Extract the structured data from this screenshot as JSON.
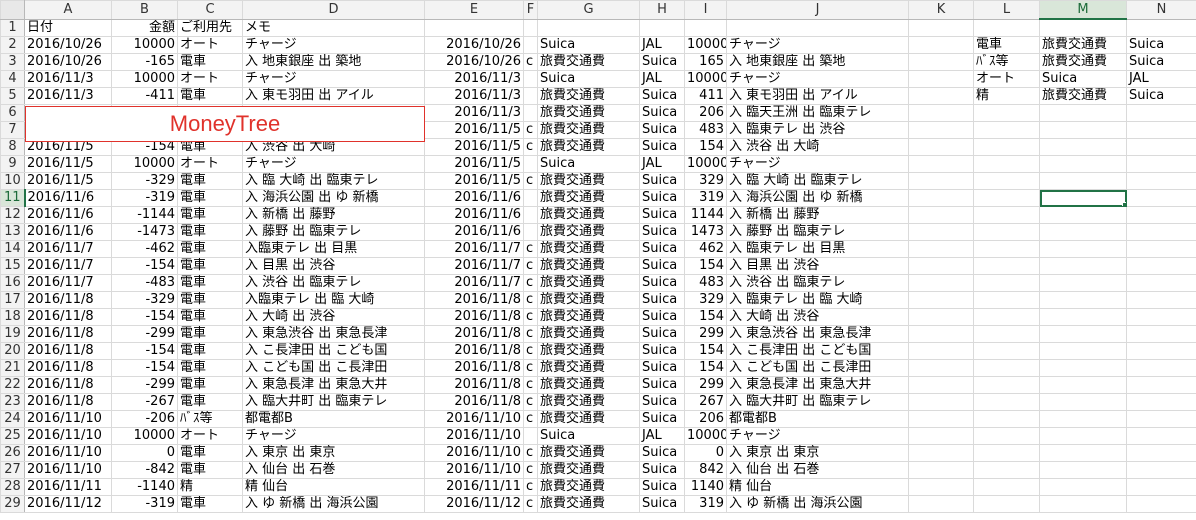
{
  "columns": [
    "A",
    "B",
    "C",
    "D",
    "E",
    "F",
    "G",
    "H",
    "I",
    "J",
    "K",
    "L",
    "M",
    "N"
  ],
  "selected_column": "M",
  "selected_row": 11,
  "overlay_label": "MoneyTree",
  "rows": [
    {
      "n": "1",
      "cells": [
        "日付",
        "金額",
        "ご利用先",
        "メモ",
        "",
        "",
        "",
        "",
        "",
        "",
        "",
        "",
        "",
        ""
      ]
    },
    {
      "n": "2",
      "cells": [
        "2016/10/26",
        "10000",
        "オート",
        "チャージ",
        "2016/10/26",
        "",
        "Suica",
        "JAL",
        "10000",
        "チャージ",
        "",
        "電車",
        "旅費交通費",
        "Suica"
      ]
    },
    {
      "n": "3",
      "cells": [
        "2016/10/26",
        "-165",
        "電車",
        "入 地東銀座 出 築地",
        "2016/10/26",
        "c",
        "旅費交通費",
        "Suica",
        "165",
        "入 地東銀座 出 築地",
        "",
        "ﾊﾞｽ等",
        "旅費交通費",
        "Suica"
      ]
    },
    {
      "n": "4",
      "cells": [
        "2016/11/3",
        "10000",
        "オート",
        "チャージ",
        "2016/11/3",
        "",
        "Suica",
        "JAL",
        "10000",
        "チャージ",
        "",
        "オート",
        "Suica",
        "JAL"
      ]
    },
    {
      "n": "5",
      "cells": [
        "2016/11/3",
        "-411",
        "電車",
        "入 東モ羽田 出 アイル",
        "2016/11/3",
        "",
        "旅費交通費",
        "Suica",
        "411",
        "入 東モ羽田 出 アイル",
        "",
        "精",
        "旅費交通費",
        "Suica"
      ]
    },
    {
      "n": "6",
      "cells": [
        "",
        "",
        "",
        "",
        "2016/11/3",
        "",
        "旅費交通費",
        "Suica",
        "206",
        "入 臨天王洲 出 臨東テレ",
        "",
        "",
        "",
        ""
      ]
    },
    {
      "n": "7",
      "cells": [
        "",
        "",
        "",
        "",
        "2016/11/5",
        "c",
        "旅費交通費",
        "Suica",
        "483",
        "入 臨東テレ 出 渋谷",
        "",
        "",
        "",
        ""
      ]
    },
    {
      "n": "8",
      "cells": [
        "2016/11/5",
        "-154",
        "電車",
        "入 渋谷 出 大崎",
        "2016/11/5",
        "c",
        "旅費交通費",
        "Suica",
        "154",
        "入 渋谷 出 大崎",
        "",
        "",
        "",
        ""
      ]
    },
    {
      "n": "9",
      "cells": [
        "2016/11/5",
        "10000",
        "オート",
        "チャージ",
        "2016/11/5",
        "",
        "Suica",
        "JAL",
        "10000",
        "チャージ",
        "",
        "",
        "",
        ""
      ]
    },
    {
      "n": "10",
      "cells": [
        "2016/11/5",
        "-329",
        "電車",
        "入 臨 大崎 出 臨東テレ",
        "2016/11/5",
        "c",
        "旅費交通費",
        "Suica",
        "329",
        "入 臨 大崎 出 臨東テレ",
        "",
        "",
        "",
        ""
      ]
    },
    {
      "n": "11",
      "cells": [
        "2016/11/6",
        "-319",
        "電車",
        "入 海浜公園 出 ゆ 新橋",
        "2016/11/6",
        "",
        "旅費交通費",
        "Suica",
        "319",
        "入 海浜公園 出 ゆ 新橋",
        "",
        "",
        "",
        ""
      ]
    },
    {
      "n": "12",
      "cells": [
        "2016/11/6",
        "-1144",
        "電車",
        "入 新橋 出 藤野",
        "2016/11/6",
        "",
        "旅費交通費",
        "Suica",
        "1144",
        "入 新橋 出 藤野",
        "",
        "",
        "",
        ""
      ]
    },
    {
      "n": "13",
      "cells": [
        "2016/11/6",
        "-1473",
        "電車",
        "入 藤野 出 臨東テレ",
        "2016/11/6",
        "",
        "旅費交通費",
        "Suica",
        "1473",
        "入 藤野 出 臨東テレ",
        "",
        "",
        "",
        ""
      ]
    },
    {
      "n": "14",
      "cells": [
        "2016/11/7",
        "-462",
        "電車",
        "入臨東テレ 出 目黒",
        "2016/11/7",
        "c",
        "旅費交通費",
        "Suica",
        "462",
        "入 臨東テレ 出 目黒",
        "",
        "",
        "",
        ""
      ]
    },
    {
      "n": "15",
      "cells": [
        "2016/11/7",
        "-154",
        "電車",
        "入 目黒 出 渋谷",
        "2016/11/7",
        "c",
        "旅費交通費",
        "Suica",
        "154",
        "入 目黒 出 渋谷",
        "",
        "",
        "",
        ""
      ]
    },
    {
      "n": "16",
      "cells": [
        "2016/11/7",
        "-483",
        "電車",
        "入 渋谷 出 臨東テレ",
        "2016/11/7",
        "c",
        "旅費交通費",
        "Suica",
        "483",
        "入 渋谷 出 臨東テレ",
        "",
        "",
        "",
        ""
      ]
    },
    {
      "n": "17",
      "cells": [
        "2016/11/8",
        "-329",
        "電車",
        "入臨東テレ 出 臨 大崎",
        "2016/11/8",
        "c",
        "旅費交通費",
        "Suica",
        "329",
        "入 臨東テレ 出 臨 大崎",
        "",
        "",
        "",
        ""
      ]
    },
    {
      "n": "18",
      "cells": [
        "2016/11/8",
        "-154",
        "電車",
        "入 大崎 出 渋谷",
        "2016/11/8",
        "c",
        "旅費交通費",
        "Suica",
        "154",
        "入 大崎 出 渋谷",
        "",
        "",
        "",
        ""
      ]
    },
    {
      "n": "19",
      "cells": [
        "2016/11/8",
        "-299",
        "電車",
        "入 東急渋谷 出 東急長津",
        "2016/11/8",
        "c",
        "旅費交通費",
        "Suica",
        "299",
        "入 東急渋谷 出 東急長津",
        "",
        "",
        "",
        ""
      ]
    },
    {
      "n": "20",
      "cells": [
        "2016/11/8",
        "-154",
        "電車",
        "入 こ長津田 出 こども国",
        "2016/11/8",
        "c",
        "旅費交通費",
        "Suica",
        "154",
        "入 こ長津田 出 こども国",
        "",
        "",
        "",
        ""
      ]
    },
    {
      "n": "21",
      "cells": [
        "2016/11/8",
        "-154",
        "電車",
        "入 こども国 出 こ長津田",
        "2016/11/8",
        "c",
        "旅費交通費",
        "Suica",
        "154",
        "入 こども国 出 こ長津田",
        "",
        "",
        "",
        ""
      ]
    },
    {
      "n": "22",
      "cells": [
        "2016/11/8",
        "-299",
        "電車",
        "入 東急長津 出 東急大井",
        "2016/11/8",
        "c",
        "旅費交通費",
        "Suica",
        "299",
        "入 東急長津 出 東急大井",
        "",
        "",
        "",
        ""
      ]
    },
    {
      "n": "23",
      "cells": [
        "2016/11/8",
        "-267",
        "電車",
        "入 臨大井町 出 臨東テレ",
        "2016/11/8",
        "c",
        "旅費交通費",
        "Suica",
        "267",
        "入 臨大井町 出 臨東テレ",
        "",
        "",
        "",
        ""
      ]
    },
    {
      "n": "24",
      "cells": [
        "2016/11/10",
        "-206",
        "ﾊﾞｽ等",
        "都電都B",
        "2016/11/10",
        "c",
        "旅費交通費",
        "Suica",
        "206",
        "都電都B",
        "",
        "",
        "",
        ""
      ]
    },
    {
      "n": "25",
      "cells": [
        "2016/11/10",
        "10000",
        "オート",
        "チャージ",
        "2016/11/10",
        "",
        "Suica",
        "JAL",
        "10000",
        "チャージ",
        "",
        "",
        "",
        ""
      ]
    },
    {
      "n": "26",
      "cells": [
        "2016/11/10",
        "0",
        "電車",
        "入 東京 出 東京",
        "2016/11/10",
        "c",
        "旅費交通費",
        "Suica",
        "0",
        "入 東京 出 東京",
        "",
        "",
        "",
        ""
      ]
    },
    {
      "n": "27",
      "cells": [
        "2016/11/10",
        "-842",
        "電車",
        "入 仙台 出 石巻",
        "2016/11/10",
        "c",
        "旅費交通費",
        "Suica",
        "842",
        "入 仙台 出 石巻",
        "",
        "",
        "",
        ""
      ]
    },
    {
      "n": "28",
      "cells": [
        "2016/11/11",
        "-1140",
        "精",
        "精 仙台",
        "2016/11/11",
        "c",
        "旅費交通費",
        "Suica",
        "1140",
        "精 仙台",
        "",
        "",
        "",
        ""
      ]
    },
    {
      "n": "29",
      "cells": [
        "2016/11/12",
        "-319",
        "電車",
        "入 ゆ 新橋 出 海浜公園",
        "2016/11/12",
        "c",
        "旅費交通費",
        "Suica",
        "319",
        "入 ゆ 新橋 出 海浜公園",
        "",
        "",
        "",
        ""
      ]
    }
  ]
}
